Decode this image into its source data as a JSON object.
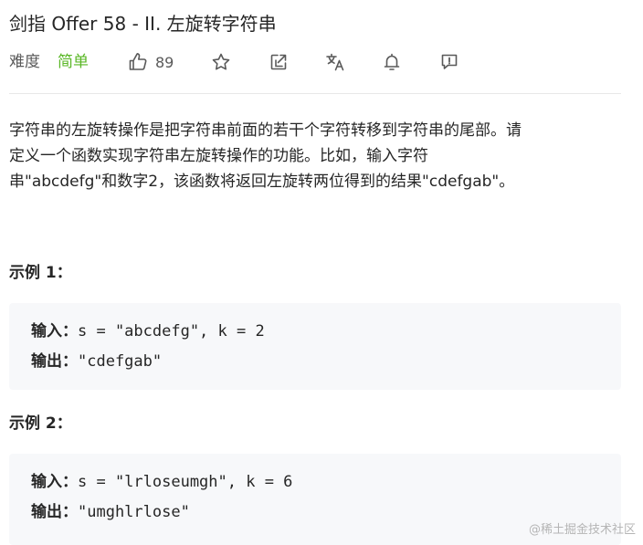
{
  "problem": {
    "title": "剑指 Offer 58 - II. 左旋转字符串",
    "difficulty_label": "难度",
    "difficulty_value": "简单",
    "likes": "89"
  },
  "icons": {
    "like": "thumbs-up-icon",
    "favorite": "star-icon",
    "share": "share-icon",
    "translate": "translate-icon",
    "notify": "bell-icon",
    "feedback": "feedback-icon"
  },
  "colors": {
    "easy": "#5ab726",
    "code_bg": "#f7f8fa",
    "divider": "#e8e8e8"
  },
  "description": {
    "lines": [
      "字符串的左旋转操作是把字符串前面的若干个字符转移到字符串的尾部。请",
      "定义一个函数实现字符串左旋转操作的功能。比如，输入字符",
      "串\"abcdefg\"和数字2，该函数将返回左旋转两位得到的结果\"cdefgab\"。"
    ]
  },
  "examples": [
    {
      "heading": "示例 1：",
      "input_label": "输入：",
      "input_value": "s = \"abcdefg\", k = 2",
      "output_label": "输出：",
      "output_value": "\"cdefgab\""
    },
    {
      "heading": "示例 2：",
      "input_label": "输入：",
      "input_value": "s = \"lrloseumgh\", k = 6",
      "output_label": "输出：",
      "output_value": "\"umghlrlose\""
    }
  ],
  "watermark": "@稀土掘金技术社区"
}
